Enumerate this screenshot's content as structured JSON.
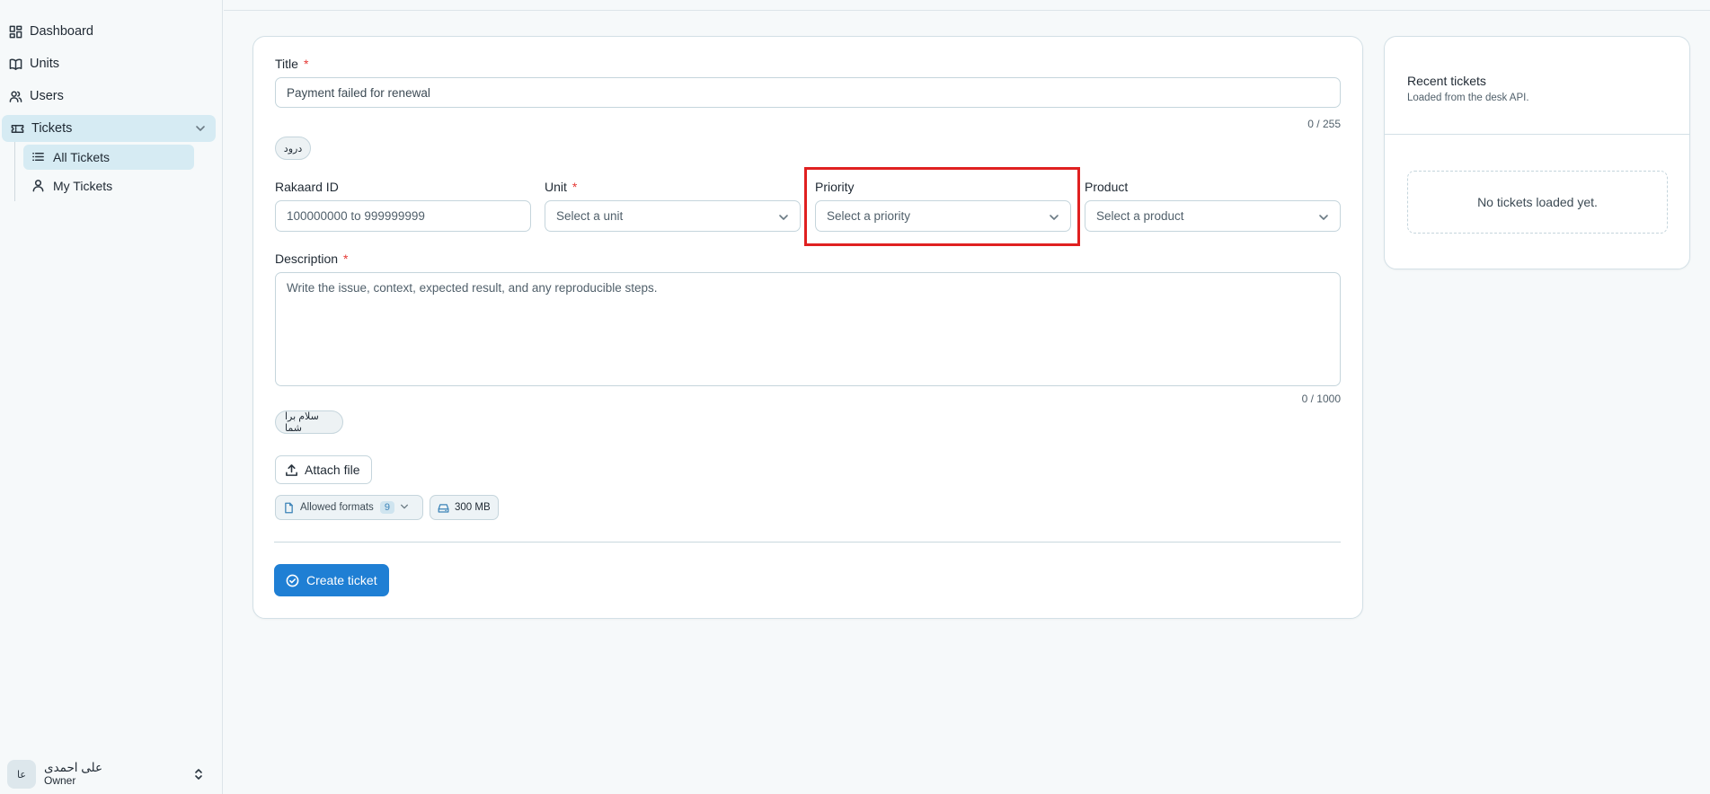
{
  "sidebar": {
    "items": [
      {
        "label": "Dashboard",
        "icon": "dashboard-icon"
      },
      {
        "label": "Units",
        "icon": "book-icon"
      },
      {
        "label": "Users",
        "icon": "users-icon"
      },
      {
        "label": "Tickets",
        "icon": "ticket-icon"
      }
    ],
    "sub_items": [
      {
        "label": "All Tickets",
        "icon": "list-icon"
      },
      {
        "label": "My Tickets",
        "icon": "user-icon"
      }
    ],
    "user": {
      "initials": "عا",
      "name": "علی احمدی",
      "role": "Owner"
    }
  },
  "form": {
    "title_label": "Title",
    "title_value": "Payment failed for renewal",
    "title_counter": "0 / 255",
    "title_chip": "درود",
    "rakaard_label": "Rakaard ID",
    "rakaard_placeholder": "100000000 to 999999999",
    "unit_label": "Unit",
    "unit_placeholder": "Select a unit",
    "priority_label": "Priority",
    "priority_placeholder": "Select a priority",
    "product_label": "Product",
    "product_placeholder": "Select a product",
    "description_label": "Description",
    "description_placeholder": "Write the issue, context, expected result, and any reproducible steps.",
    "description_counter": "0 / 1000",
    "description_chip": "سلام برا شما",
    "required_mark": "*",
    "attach_label": "Attach file",
    "formats_label": "Allowed formats",
    "formats_count": "9",
    "size_label": "300 MB",
    "submit_label": "Create ticket"
  },
  "recent": {
    "title": "Recent tickets",
    "subtitle": "Loaded from the desk API.",
    "empty": "No tickets loaded yet."
  },
  "colors": {
    "accent": "#1f7fd4",
    "active_nav": "#d6ebf3",
    "highlight": "#e02020",
    "required": "#e53935"
  }
}
